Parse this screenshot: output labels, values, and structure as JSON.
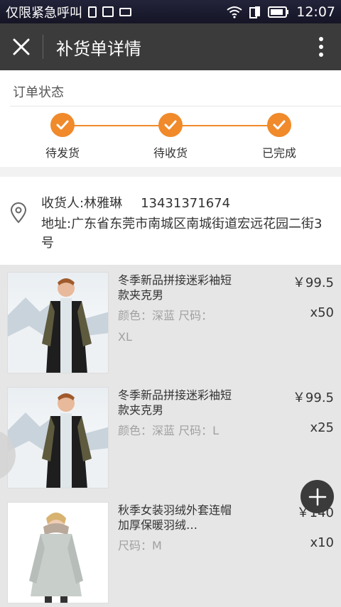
{
  "status_bar": {
    "carrier": "仅限紧急呼叫",
    "time": "12:07"
  },
  "app_bar": {
    "title": "补货单详情"
  },
  "order_status": {
    "label": "订单状态",
    "steps": [
      {
        "label": "待发货",
        "done": true
      },
      {
        "label": "待收货",
        "done": true
      },
      {
        "label": "已完成",
        "done": true
      }
    ]
  },
  "address": {
    "receiver_label": "收货人:林雅琳",
    "phone": "13431371674",
    "address_text": "地址:广东省东莞市南城区南城街道宏远花园二街3号"
  },
  "items": [
    {
      "name": "冬季新品拼接迷彩袖短款夹克男",
      "spec": "颜色：深蓝 尺码：XL",
      "price": "￥99.5",
      "qty": "x50"
    },
    {
      "name": "冬季新品拼接迷彩袖短款夹克男",
      "spec": "颜色：深蓝 尺码：L",
      "price": "￥99.5",
      "qty": "x25"
    },
    {
      "name": "秋季女装羽绒外套连帽加厚保暖羽绒…",
      "spec": "尺码：M",
      "price": "￥140",
      "qty": "x10"
    }
  ],
  "colors": {
    "accent": "#f08a2a",
    "app_bar": "#3b3b3b"
  }
}
